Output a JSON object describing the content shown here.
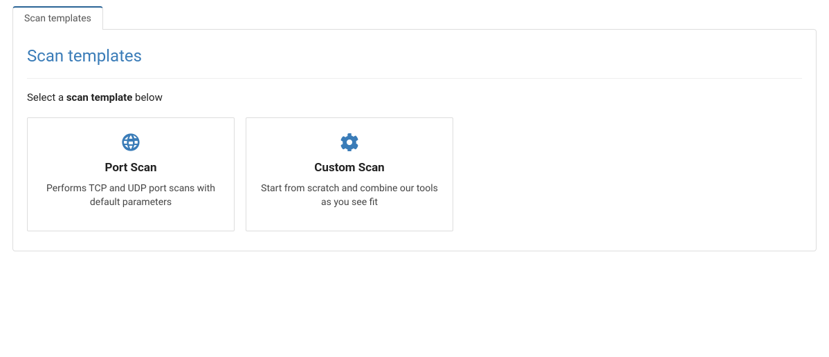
{
  "tab": {
    "label": "Scan templates"
  },
  "panel": {
    "title": "Scan templates",
    "instruction_prefix": "Select a ",
    "instruction_bold": "scan template",
    "instruction_suffix": " below"
  },
  "cards": [
    {
      "icon": "globe-icon",
      "title": "Port Scan",
      "description": "Performs TCP and UDP port scans with default parameters"
    },
    {
      "icon": "gear-icon",
      "title": "Custom Scan",
      "description": "Start from scratch and combine our tools as you see fit"
    }
  ],
  "colors": {
    "accent": "#3a7cb8",
    "border": "#ddd"
  }
}
